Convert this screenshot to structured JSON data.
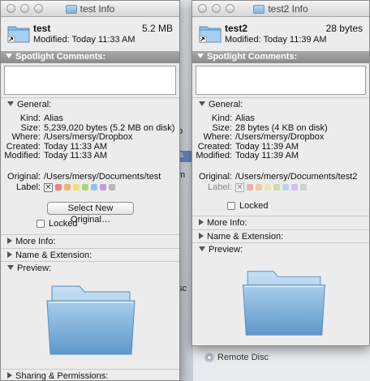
{
  "background": {
    "remote_disc_label": "Remote Disc",
    "frag_sc": "sc",
    "frag_blue": "s",
    "frag_o": "o",
    "frag_m": "m"
  },
  "window1": {
    "title": "test Info",
    "name": "test",
    "size": "5.2 MB",
    "modified_line": "Modified: Today 11:33 AM",
    "spotlight_header": "Spotlight Comments:",
    "general_header": "General:",
    "general": [
      {
        "key": "Kind:",
        "value": "Alias"
      },
      {
        "key": "Size:",
        "value": "5,239,020 bytes (5.2 MB on disk)"
      },
      {
        "key": "Where:",
        "value": "/Users/mersy/Dropbox"
      },
      {
        "key": "Created:",
        "value": "Today 11:33 AM"
      },
      {
        "key": "Modified:",
        "value": "Today 11:33 AM"
      }
    ],
    "original_key": "Original:",
    "original_value": "/Users/mersy/Documents/test",
    "label_key": "Label:",
    "label_x": "✕",
    "select_button": "Select New Original…",
    "locked_label": "Locked",
    "more_info": "More Info:",
    "name_ext": "Name & Extension:",
    "preview": "Preview:",
    "sharing": "Sharing & Permissions:"
  },
  "window2": {
    "title": "test2 Info",
    "name": "test2",
    "size": "28 bytes",
    "modified_line": "Modified: Today 11:39 AM",
    "spotlight_header": "Spotlight Comments:",
    "general_header": "General:",
    "general": [
      {
        "key": "Kind:",
        "value": "Alias"
      },
      {
        "key": "Size:",
        "value": "28 bytes (4 KB on disk)"
      },
      {
        "key": "Where:",
        "value": "/Users/mersy/Dropbox"
      },
      {
        "key": "Created:",
        "value": "Today 11:39 AM"
      },
      {
        "key": "Modified:",
        "value": "Today 11:39 AM"
      }
    ],
    "original_key": "Original:",
    "original_value": "/Users/mersy/Documents/test2",
    "label_key": "Label:",
    "label_x": "✕",
    "locked_label": "Locked",
    "more_info": "More Info:",
    "name_ext": "Name & Extension:",
    "preview": "Preview:"
  },
  "label_colors": [
    "#f08080",
    "#f3b26b",
    "#f1e07a",
    "#a9d87a",
    "#8ec3ef",
    "#c49be0",
    "#b8b8b8"
  ],
  "folder_colors": {
    "light": "#b7d6f0",
    "dark": "#6aa3d3",
    "edge": "#5a8fbd"
  }
}
